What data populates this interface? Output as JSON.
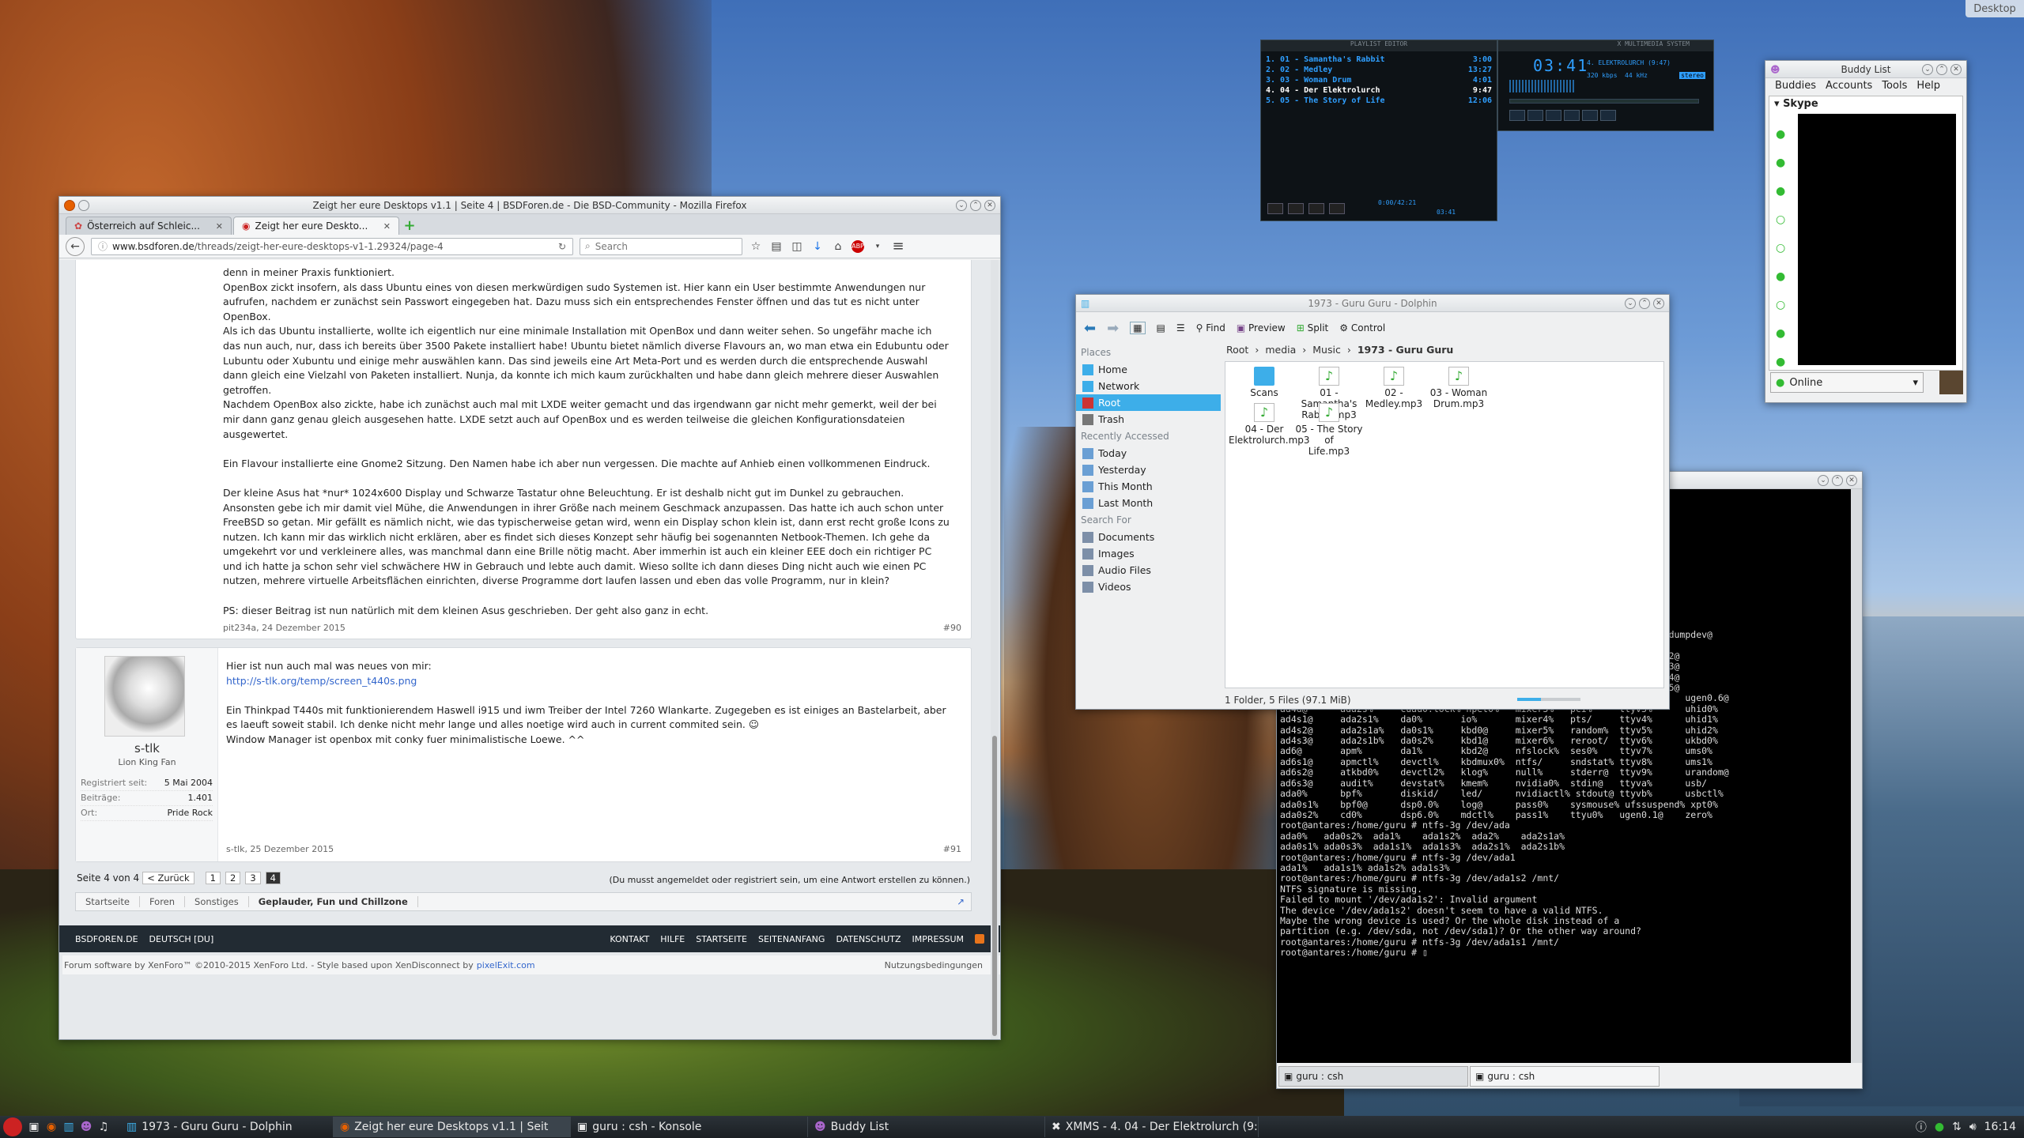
{
  "desktop": {
    "label": "Desktop"
  },
  "firefox": {
    "title": "Zeigt her eure Desktops v1.1 | Seite 4 | BSDForen.de - Die BSD-Community - Mozilla Firefox",
    "tabs": [
      {
        "label": "Österreich auf Schleic..."
      },
      {
        "label": "Zeigt her eure Deskto..."
      }
    ],
    "url_host": "www.bsdforen.de",
    "url_path": "/threads/zeigt-her-eure-desktops-v1-1.29324/page-4",
    "search_placeholder": "Search",
    "post1": {
      "lines": [
        "denn in meiner Praxis funktioniert.",
        "OpenBox zickt insofern, als dass Ubuntu eines von diesen merkwürdigen sudo Systemen ist. Hier kann ein User bestimmte Anwendungen nur",
        "aufrufen, nachdem er zunächst sein Passwort eingegeben hat. Dazu muss sich ein entsprechendes Fenster öffnen und das tut es nicht unter",
        "OpenBox.",
        "Als ich das Ubuntu installierte, wollte ich eigentlich nur eine minimale Installation mit OpenBox und dann weiter sehen. So ungefähr mache ich",
        "das nun auch, nur, dass ich bereits über 3500 Pakete installiert habe! Ubuntu bietet nämlich diverse Flavours an, wo man etwa ein Edubuntu oder",
        "Lubuntu oder Xubuntu und einige mehr auswählen kann. Das sind jeweils eine Art Meta-Port und es werden durch die entsprechende Auswahl",
        "dann gleich eine Vielzahl von Paketen installiert. Nunja, da konnte ich mich kaum zurückhalten und habe dann gleich mehrere dieser Auswahlen",
        "getroffen.",
        "Nachdem OpenBox also zickte, habe ich zunächst auch mal mit LXDE weiter gemacht und das irgendwann gar nicht mehr gemerkt, weil der bei",
        "mir dann ganz genau gleich ausgesehen hatte. LXDE setzt auch auf OpenBox und es werden teilweise die gleichen Konfigurationsdateien",
        "ausgewertet.",
        "",
        "Ein Flavour installierte eine Gnome2 Sitzung. Den Namen habe ich aber nun vergessen. Die machte auf Anhieb einen vollkommenen Eindruck.",
        "",
        "Der kleine Asus hat *nur* 1024x600 Display und Schwarze Tastatur ohne Beleuchtung. Er ist deshalb nicht gut im Dunkel zu gebrauchen.",
        "Ansonsten gebe ich mir damit viel Mühe, die Anwendungen in ihrer Größe nach meinem Geschmack anzupassen. Das hatte ich auch schon unter",
        "FreeBSD so getan. Mir gefällt es nämlich nicht, wie das typischerweise getan wird, wenn ein Display schon klein ist, dann erst recht große Icons zu",
        "nutzen. Ich kann mir das wirklich nicht erklären, aber es findet sich dieses Konzept sehr häufig bei sogenannten Netbook-Themen. Ich gehe da",
        "umgekehrt vor und verkleinere alles, was manchmal dann eine Brille nötig macht. Aber immerhin ist auch ein kleiner EEE doch ein richtiger PC",
        "und ich hatte ja schon sehr viel schwächere HW in Gebrauch und lebte auch damit. Wieso sollte ich dann dieses Ding nicht auch wie einen PC",
        "nutzen, mehrere virtuelle Arbeitsflächen einrichten, diverse Programme dort laufen lassen und eben das volle Programm, nur in klein?",
        "",
        "PS: dieser Beitrag ist nun natürlich mit dem kleinen Asus geschrieben. Der geht also ganz in echt."
      ],
      "author_date": "pit234a, 24 Dezember 2015",
      "number": "#90"
    },
    "post2": {
      "username": "s-tlk",
      "usertitle": "Lion King Fan",
      "stats": [
        {
          "k": "Registriert seit:",
          "v": "5 Mai 2004"
        },
        {
          "k": "Beiträge:",
          "v": "1.401"
        },
        {
          "k": "Ort:",
          "v": "Pride Rock"
        }
      ],
      "lines": [
        "Hier ist nun auch mal was neues von mir:",
        "http://s-tlk.org/temp/screen_t440s.png",
        "",
        "Ein Thinkpad T440s mit funktionierendem Haswell i915 und iwm Treiber der Intel 7260 Wlankarte. Zugegeben es ist einiges an Bastelarbeit, aber",
        "es laeuft soweit stabil. Ich denke nicht mehr lange und alles noetige wird auch in current commited sein. ☺",
        "Window Manager ist openbox mit conky fuer minimalistische Loewe. ^^"
      ],
      "author_date": "s-tlk, 25 Dezember 2015",
      "number": "#91"
    },
    "pagination": {
      "label": "Seite 4 von 4",
      "back": "< Zurück",
      "pages": [
        "1",
        "2",
        "3",
        "4"
      ],
      "note": "(Du musst angemeldet oder registriert sein, um eine Antwort erstellen zu können.)"
    },
    "breadcrumb": [
      "Startseite",
      "Foren",
      "Sonstiges",
      "Geplauder, Fun und Chillzone"
    ],
    "footer": {
      "left": [
        "BSDFOREN.DE",
        "DEUTSCH [DU]"
      ],
      "links": [
        "KONTAKT",
        "HILFE",
        "STARTSEITE",
        "SEITENANFANG",
        "DATENSCHUTZ",
        "IMPRESSUM"
      ],
      "credit_a": "Forum software by XenForo™ ©2010-2015 XenForo Ltd.",
      "credit_b": "- Style based upon XenDisconnect by",
      "credit_c": "pixelExit.com",
      "terms": "Nutzungsbedingungen"
    }
  },
  "dolphin": {
    "title": "1973 - Guru Guru - Dolphin",
    "toolbar": {
      "find": "Find",
      "preview": "Preview",
      "split": "Split",
      "control": "Control"
    },
    "places": {
      "header": "Places",
      "items": [
        "Home",
        "Network",
        "Root",
        "Trash"
      ],
      "recent_header": "Recently Accessed",
      "recent": [
        "Today",
        "Yesterday",
        "This Month",
        "Last Month"
      ],
      "search_header": "Search For",
      "search": [
        "Documents",
        "Images",
        "Audio Files",
        "Videos"
      ]
    },
    "breadcrumb": [
      "Root",
      "media",
      "Music",
      "1973 - Guru Guru"
    ],
    "files": [
      {
        "name": "Scans",
        "type": "folder"
      },
      {
        "name": "01 - Samantha's\nRabbit.mp3",
        "type": "audio"
      },
      {
        "name": "02 - Medley.mp3",
        "type": "audio"
      },
      {
        "name": "03 - Woman\nDrum.mp3",
        "type": "audio"
      },
      {
        "name": "04 - Der\nElektrolurch.mp3",
        "type": "audio"
      },
      {
        "name": "05 - The Story of\nLife.mp3",
        "type": "audio"
      }
    ],
    "status": "1 Folder, 5 Files (97.1 MiB)"
  },
  "xmms": {
    "playlist_title": "PLAYLIST EDITOR",
    "playlist": [
      {
        "t": "1. 01 - Samantha's Rabbit",
        "d": "3:00"
      },
      {
        "t": "2. 02 - Medley",
        "d": "13:27"
      },
      {
        "t": "3. 03 - Woman Drum",
        "d": "4:01"
      },
      {
        "t": "4. 04 - Der Elektrolurch",
        "d": "9:47"
      },
      {
        "t": "5. 05 - The Story of Life",
        "d": "12:06"
      }
    ],
    "main_title": "X MULTIMEDIA SYSTEM",
    "time": "03:41",
    "song": "4. ELEKTROLURCH (9:47)",
    "kbps": "320 kbps",
    "khz": "44 kHz",
    "mode": "stereo",
    "total": "0:00/42:21",
    "remain": "03:41"
  },
  "pidgin": {
    "title": "Buddy List",
    "menu": [
      "Buddies",
      "Accounts",
      "Tools",
      "Help"
    ],
    "group": "Skype",
    "status": "Online"
  },
  "konsole": {
    "tabs": [
      "guru : csh",
      "guru : csh"
    ],
    "lines": [
      "                                                     dsp0.0%  dsp6.0%  dumpdev@",
      "",
      "                                                     ttyu0.init% ugen0.2@",
      "                                                     ttyu0.lock% ugen0.3@",
      "                                                     ttyv0%      ugen0.4@",
      "                                                     ttyv1%      ugen0.5@",
      "ada0s2a@   ada2%      cuau0.init geom.ctl  mixer2%   pass0%   ttyv2%      ugen0.6@",
      "ad4d@      ada2s%     cuau0.lock% hpet0%   mixer3%   pci%     ttyv3%      uhid0%",
      "ad4s1@     ada2s1%    da0%       io%       mixer4%   pts/     ttyv4%      uhid1%",
      "ad4s2@     ada2s1a%   da0s1%     kbd0@     mixer5%   random%  ttyv5%      uhid2%",
      "ad4s3@     ada2s1b%   da0s2%     kbd1@     mixer6%   reroot/  ttyv6%      ukbd0%",
      "ad6@       apm%       da1%       kbd2@     nfslock%  ses0%    ttyv7%      ums0%",
      "ad6s1@     apmctl%    devctl%    kbdmux0%  ntfs/     sndstat% ttyv8%      ums1%",
      "ad6s2@     atkbd0%    devctl2%   klog%     null%     stderr@  ttyv9%      urandom@",
      "ad6s3@     audit%     devstat%   kmem%     nvidia0%  stdin@   ttyva%      usb/",
      "ada0%      bpf%       diskid/    led/      nvidiactl% stdout@ ttyvb%      usbctl%",
      "ada0s1%    bpf0@      dsp0.0%    log@      pass0%    sysmouse% ufssuspend% xpt0%",
      "ada0s2%    cd0%       dsp6.0%    mdctl%    pass1%    ttyu0%   ugen0.1@    zero%",
      "root@antares:/home/guru # ntfs-3g /dev/ada",
      "ada0%   ada0s2%  ada1%    ada1s2%  ada2%    ada2s1a%",
      "ada0s1% ada0s3%  ada1s1%  ada1s3%  ada2s1%  ada2s1b%",
      "root@antares:/home/guru # ntfs-3g /dev/ada1",
      "ada1%   ada1s1% ada1s2% ada1s3%",
      "root@antares:/home/guru # ntfs-3g /dev/ada1s2 /mnt/",
      "NTFS signature is missing.",
      "Failed to mount '/dev/ada1s2': Invalid argument",
      "The device '/dev/ada1s2' doesn't seem to have a valid NTFS.",
      "Maybe the wrong device is used? Or the whole disk instead of a",
      "partition (e.g. /dev/sda, not /dev/sda1)? Or the other way around?",
      "root@antares:/home/guru # ntfs-3g /dev/ada1s1 /mnt/",
      "root@antares:/home/guru # ▯"
    ]
  },
  "panel": {
    "tasks": [
      "1973 - Guru Guru - Dolphin",
      "Zeigt her eure Desktops v1.1 | Seit",
      "guru : csh - Konsole",
      "Buddy List",
      "XMMS - 4. 04 - Der Elektrolurch (9:"
    ],
    "clock": "16:14"
  }
}
